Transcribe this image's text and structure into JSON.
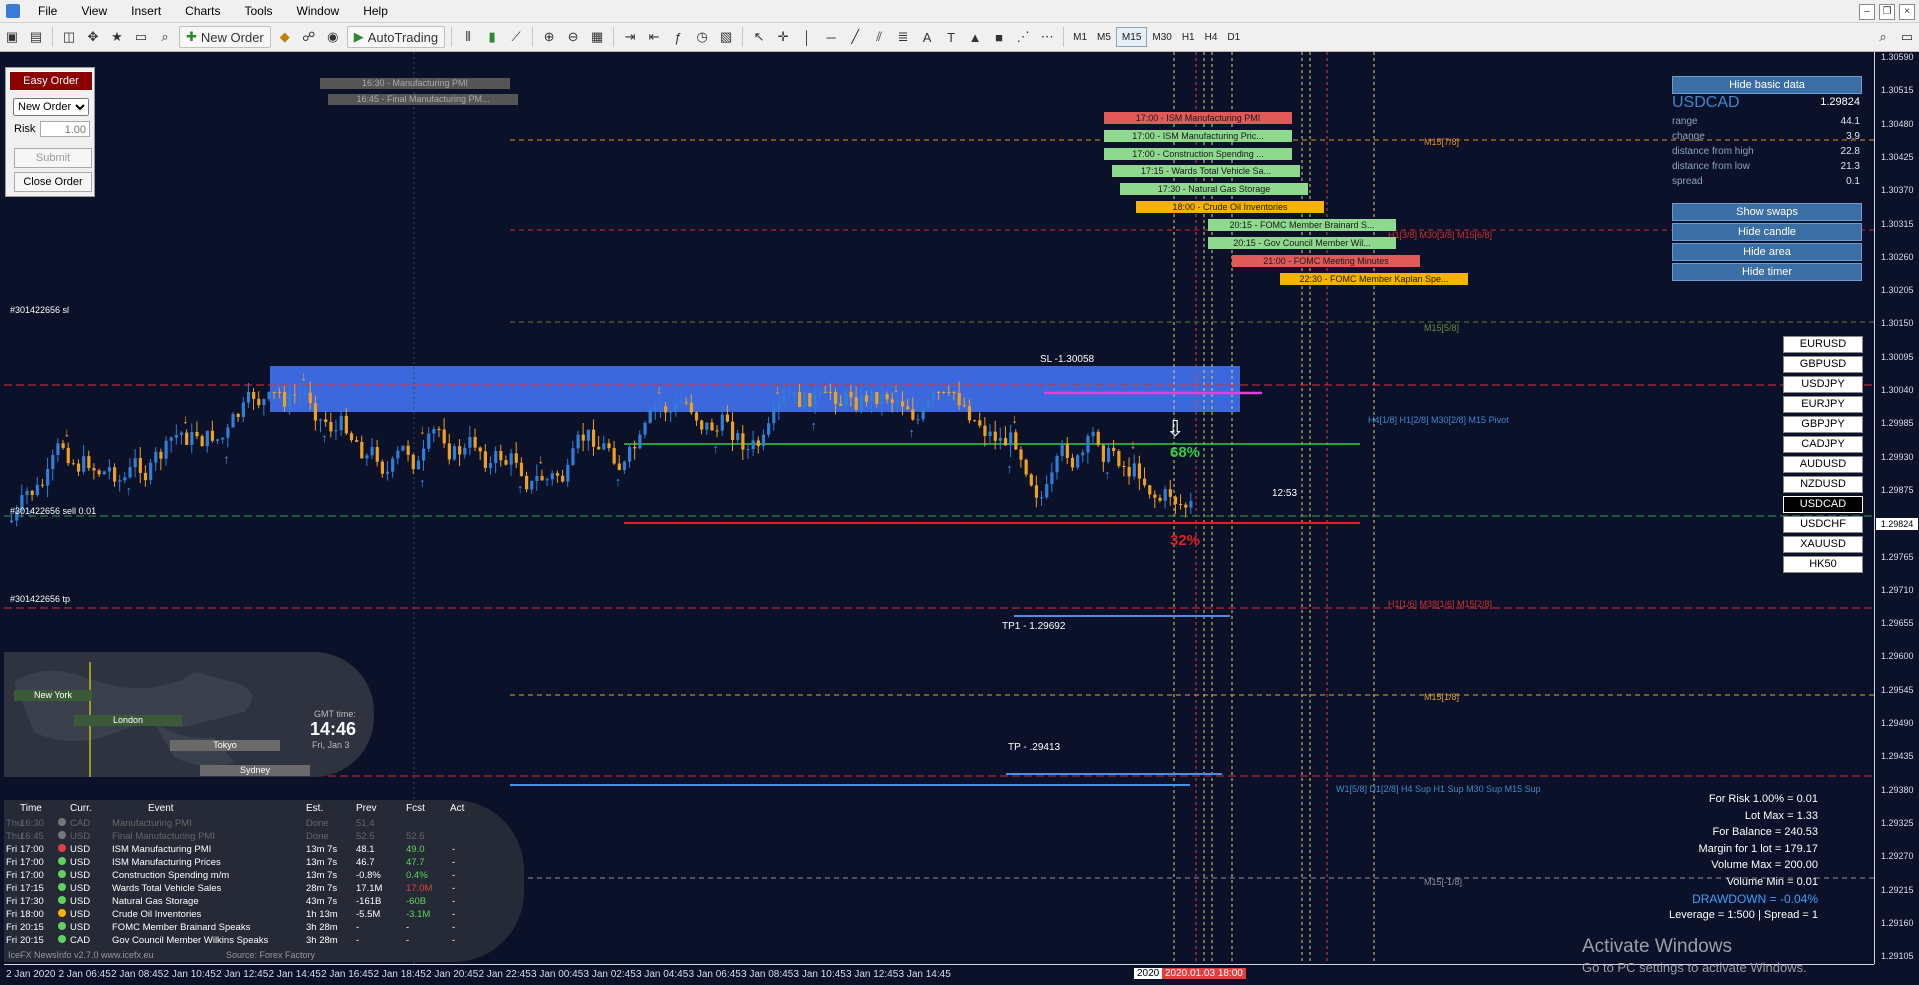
{
  "menu": {
    "items": [
      "File",
      "View",
      "Insert",
      "Charts",
      "Tools",
      "Window",
      "Help"
    ]
  },
  "toolbar": {
    "new_order": "New Order",
    "autotrading": "AutoTrading",
    "timeframes": [
      "M1",
      "M5",
      "M15",
      "M30",
      "H1",
      "H4",
      "D1"
    ],
    "active_timeframe": "M15"
  },
  "easy_order": {
    "title": "Easy Order",
    "order_type": "New Order",
    "risk_label": "Risk",
    "risk_value": "1.00",
    "submit": "Submit",
    "close": "Close Order"
  },
  "events": [
    {
      "label": "16:30 - Manufacturing PMI",
      "color": "#666666"
    },
    {
      "label": "16:45 - Final Manufacturing PM...",
      "color": "#666666"
    },
    {
      "label": "17:00 - ISM Manufacturing PMI",
      "color": "#e05a5a"
    },
    {
      "label": "17:00 - ISM Manufacturing Pric...",
      "color": "#8fd98f"
    },
    {
      "label": "17:00 - Construction Spending ...",
      "color": "#8fd98f"
    },
    {
      "label": "17:15 - Wards Total Vehicle Sa...",
      "color": "#8fd98f"
    },
    {
      "label": "17:30 - Natural Gas Storage",
      "color": "#8fd98f"
    },
    {
      "label": "18:00 - Crude Oil Inventories",
      "color": "#f5b400"
    },
    {
      "label": "20:15 - FOMC Member Brainard S...",
      "color": "#8fd98f"
    },
    {
      "label": "20:15 - Gov Council Member Wil...",
      "color": "#8fd98f"
    },
    {
      "label": "21:00 - FOMC Meeting Minutes",
      "color": "#e05a5a"
    },
    {
      "label": "22:30 - FOMC Member Kaplan Spe...",
      "color": "#f5b400"
    }
  ],
  "basic_data": {
    "hide_button": "Hide basic data",
    "symbol": "USDCAD",
    "price": "1.29824",
    "rows": [
      {
        "label": "range",
        "value": "44.1"
      },
      {
        "label": "change",
        "value": "3.9"
      },
      {
        "label": "distance from high",
        "value": "22.8"
      },
      {
        "label": "distance from low",
        "value": "21.3"
      },
      {
        "label": "spread",
        "value": "0.1"
      }
    ],
    "buttons": [
      "Show swaps",
      "Hide candle",
      "Hide area",
      "Hide timer"
    ]
  },
  "symbols": [
    "EURUSD",
    "GBPUSD",
    "USDJPY",
    "EURJPY",
    "GBPJPY",
    "CADJPY",
    "AUDUSD",
    "NZDUSD",
    "USDCAD",
    "USDCHF",
    "XAUUSD",
    "HK50"
  ],
  "selected_symbol": "USDCAD",
  "price_axis": [
    "1.30590",
    "1.30515",
    "1.30480",
    "1.30425",
    "1.30370",
    "1.30315",
    "1.30260",
    "1.30205",
    "1.30150",
    "1.30095",
    "1.30040",
    "1.29985",
    "1.29930",
    "1.29875",
    "1.29824",
    "1.29765",
    "1.29710",
    "1.29655",
    "1.29600",
    "1.29545",
    "1.29490",
    "1.29435",
    "1.29380",
    "1.29325",
    "1.29270",
    "1.29215",
    "1.29160",
    "1.29105"
  ],
  "current_price": "1.29824",
  "time_axis": [
    "2 Jan 2020",
    "2 Jan 06:45",
    "2 Jan 08:45",
    "2 Jan 10:45",
    "2 Jan 12:45",
    "2 Jan 14:45",
    "2 Jan 16:45",
    "2 Jan 18:45",
    "2 Jan 20:45",
    "2 Jan 22:45",
    "3 Jan 00:45",
    "3 Jan 02:45",
    "3 Jan 04:45",
    "3 Jan 06:45",
    "3 Jan 08:45",
    "3 Jan 10:45",
    "3 Jan 12:45",
    "3 Jan 14:45"
  ],
  "time_axis_highlight": {
    "now": "2020",
    "date": "2020.01.03 18:00"
  },
  "chart_labels": {
    "sl_order": "#301422656 sl",
    "sell_order": "#301422656 sell 0.01",
    "tp_order": "#301422656 tp",
    "sl_price": "SL -1.30058",
    "tp1": "TP1 - 1.29692",
    "tp": "TP - .29413",
    "pct_up": "68%",
    "pct_down": "32%",
    "timer": "12:53",
    "m15_78": "M15[7/8]",
    "m15_58": "M15[5/8]",
    "m15_38": "M15[3/8]",
    "m15_18": "M15[1/8]",
    "m15_m18": "M15[-1/8]",
    "h1_38": "H1[3/8] M30[3/8] M15[6/8]",
    "pivot": "H4[1/8] H1[2/8] M30[2/8] M15 Pivot",
    "h1_16": "H1[1/6] M38[1/6] M15[2/8]",
    "w1_sup": "W1[5/8] D1[2/8] H4 Sup H1 Sup M30 Sup M15 Sup"
  },
  "world_clock": {
    "sessions": [
      "New York",
      "London",
      "Tokyo",
      "Sydney"
    ],
    "gmt_label": "GMT time:",
    "time": "14:46",
    "date": "Fri, Jan 3"
  },
  "news_table": {
    "headers": [
      "Time",
      "Curr.",
      "Event",
      "Est.",
      "Prev",
      "Fcst",
      "Act"
    ],
    "rows": [
      {
        "day": "Thu",
        "time": "16:30",
        "curr": "CAD",
        "event": "Manufacturing PMI",
        "est": "Done",
        "prev": "51.4",
        "fcst": "",
        "act": "",
        "dot": "#777777",
        "dim": true
      },
      {
        "day": "Thu",
        "time": "16:45",
        "curr": "USD",
        "event": "Final Manufacturing PMI",
        "est": "Done",
        "prev": "52.5",
        "fcst": "52.5",
        "act": "",
        "dot": "#777777",
        "dim": true
      },
      {
        "day": "Fri",
        "time": "17:00",
        "curr": "USD",
        "event": "ISM Manufacturing PMI",
        "est": "13m 7s",
        "prev": "48.1",
        "fcst": "49.0",
        "act": "-",
        "dot": "#e04040",
        "dim": false
      },
      {
        "day": "Fri",
        "time": "17:00",
        "curr": "USD",
        "event": "ISM Manufacturing Prices",
        "est": "13m 7s",
        "prev": "46.7",
        "fcst": "47.7",
        "act": "-",
        "dot": "#5fd35f",
        "dim": false
      },
      {
        "day": "Fri",
        "time": "17:00",
        "curr": "USD",
        "event": "Construction Spending m/m",
        "est": "13m 7s",
        "prev": "-0.8%",
        "fcst": "0.4%",
        "act": "-",
        "dot": "#5fd35f",
        "dim": false
      },
      {
        "day": "Fri",
        "time": "17:15",
        "curr": "USD",
        "event": "Wards Total Vehicle Sales",
        "est": "28m 7s",
        "prev": "17.1M",
        "fcst": "17.0M",
        "act": "-",
        "dot": "#5fd35f",
        "dim": false
      },
      {
        "day": "Fri",
        "time": "17:30",
        "curr": "USD",
        "event": "Natural Gas Storage",
        "est": "43m 7s",
        "prev": "-161B",
        "fcst": "-60B",
        "act": "-",
        "dot": "#5fd35f",
        "dim": false
      },
      {
        "day": "Fri",
        "time": "18:00",
        "curr": "USD",
        "event": "Crude Oil Inventories",
        "est": "1h 13m",
        "prev": "-5.5M",
        "fcst": "-3.1M",
        "act": "-",
        "dot": "#f5b400",
        "dim": false
      },
      {
        "day": "Fri",
        "time": "20:15",
        "curr": "USD",
        "event": "FOMC Member Brainard Speaks",
        "est": "3h 28m",
        "prev": "-",
        "fcst": "-",
        "act": "-",
        "dot": "#5fd35f",
        "dim": false
      },
      {
        "day": "Fri",
        "time": "20:15",
        "curr": "CAD",
        "event": "Gov Council Member Wilkins Speaks",
        "est": "3h 28m",
        "prev": "-",
        "fcst": "-",
        "act": "-",
        "dot": "#5fd35f",
        "dim": false
      }
    ],
    "footer_left": "IceFX NewsInfo v2.7.0   www.icefx.eu",
    "footer_right": "Source: Forex Factory"
  },
  "account_stats": [
    "For Risk 1.00% = 0.01",
    "Lot Max = 1.33",
    "For Balance = 240.53",
    "Margin for 1 lot = 179.17",
    "Volume Max = 200.00",
    "Volume Min = 0.01",
    "DRAWDOWN = -0.04%",
    "Leverage = 1:500 | Spread = 1"
  ],
  "watermark": {
    "title": "Activate Windows",
    "subtitle": "Go to PC settings to activate Windows."
  }
}
